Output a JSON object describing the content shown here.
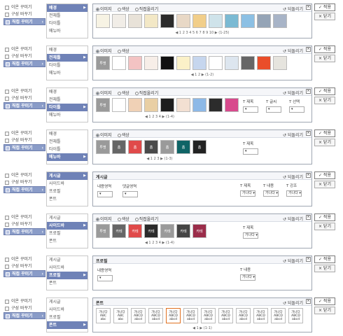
{
  "left_menu": {
    "items": [
      {
        "icon": "magnifier-icon",
        "label": "이온 꾸미기"
      },
      {
        "icon": "doc-icon",
        "label": "구성 바꾸기"
      },
      {
        "icon": "pencil-icon",
        "label": "직접 꾸미기",
        "selected": true
      }
    ]
  },
  "rows": [
    {
      "mid": [
        "배경",
        "전체틀",
        "타이틀",
        "메뉴바"
      ],
      "mid_sel": 0,
      "radios": [
        "이미지",
        "색상",
        "직접올리기"
      ],
      "radio_on": 0,
      "reset": "되돌리기",
      "thumb_colors": [
        "#f7f3e4",
        "#f1ede7",
        "#e8e2d8",
        "#f3e8c6",
        "#2b2b2b",
        "#e8d8c6",
        "#f1ce8a",
        "#cfe3ea",
        "#7bbad3",
        "#8cc0e4",
        "#95a4b6",
        "#a8b4c7"
      ],
      "pager": "◀ 1 2 3 4 5 6 7 8 9 10 ▶ (1-25)"
    },
    {
      "mid": [
        "배경",
        "전체틀",
        "타이틀",
        "메뉴바"
      ],
      "mid_sel": 1,
      "radios": [
        "이미지",
        "색상"
      ],
      "radio_on": 0,
      "reset": "되돌리기",
      "thumb_colors": [
        "#9a9a9a",
        "#ffffff",
        "#f3c3c3",
        "#f7eee8",
        "#111111",
        "#fbf1c8",
        "#c6d6ee",
        "#ffffff",
        "#dde6ef",
        "#666666",
        "#ea4e2a",
        "#e6e4de"
      ],
      "thumb_labels": [
        "투명",
        "",
        "",
        "",
        "",
        "",
        "",
        "",
        "",
        "",
        "",
        ""
      ],
      "pager": "◀ 1 2 ▶ (1-2)"
    },
    {
      "mid": [
        "배경",
        "전체틀",
        "타이틀",
        "메뉴바"
      ],
      "mid_sel": 2,
      "radios": [
        "이미지",
        "색상",
        "직접올리기"
      ],
      "radio_on": 0,
      "reset": "되돌리기",
      "thumb_colors": [
        "#9a9a9a",
        "#ffffff",
        "#f0d1b6",
        "#e9cfa4",
        "#1e1e1e",
        "#f3e0d2",
        "#8db9e7",
        "#2c2c2c",
        "#d84a8d"
      ],
      "thumb_labels": [
        "투명",
        "",
        "",
        "",
        "",
        "",
        "",
        "",
        ""
      ],
      "pager": "◀ 1 2 3 4 ▶ (1-4)",
      "opts": [
        {
          "label": "T 제목",
          "value": ""
        },
        {
          "label": "T 글씨",
          "value": ""
        },
        {
          "label": "T 선택",
          "value": ""
        }
      ]
    },
    {
      "mid": [
        "배경",
        "전체틀",
        "타이틀",
        "메뉴바"
      ],
      "mid_sel": 3,
      "radios": [
        "이미지",
        "색상"
      ],
      "radio_on": 0,
      "reset": "되돌리기",
      "thumb_colors": [
        "#9a9a9a",
        "#666666",
        "#e04a4a",
        "#4a4a4a",
        "#9a9a9a",
        "#0f6466",
        "#222222"
      ],
      "thumb_labels": [
        "투명",
        "홈",
        "홈",
        "홈",
        "홈",
        "홈",
        "홈"
      ],
      "pager": "◀ 1 2 3 ▶ (1-3)",
      "opts": [
        {
          "label": "T 제목",
          "value": ""
        }
      ]
    },
    {
      "mid": [
        "게시글",
        "사이드바",
        "프로필",
        "폰트"
      ],
      "mid_sel": 0,
      "title": "게시글",
      "reset": "되돌리기",
      "areas": [
        "내용영역",
        "댓글영역"
      ],
      "opts": [
        {
          "label": "T 제목",
          "value": "가나다"
        },
        {
          "label": "T 내용",
          "value": "가나다"
        },
        {
          "label": "T 강조",
          "value": "가나다"
        }
      ]
    },
    {
      "mid": [
        "게시글",
        "사이드바",
        "프로필",
        "폰트"
      ],
      "mid_sel": 1,
      "radios": [
        "이미지",
        "색상",
        "직접올리기"
      ],
      "radio_on": 0,
      "reset": "되돌리기",
      "thumb_colors": [
        "#9a9a9a",
        "#666666",
        "#e04a4a",
        "#2b2b2b",
        "#9a9a9a",
        "#444444",
        "#9b2d4a"
      ],
      "thumb_labels": [
        "투명",
        "카테",
        "카테",
        "카테",
        "카테",
        "카테",
        "카테"
      ],
      "pager": "◀ 1 2 3 4 ▶ (1-4)",
      "opts": [
        {
          "label": "T 제목",
          "value": "가나다"
        }
      ]
    },
    {
      "mid": [
        "게시글",
        "사이드바",
        "프로필",
        "폰트"
      ],
      "mid_sel": 2,
      "title": "프로필",
      "reset": "되돌리기",
      "areas": [
        "내용영역"
      ],
      "opts": [
        {
          "label": "T 내용",
          "value": "가나다"
        }
      ]
    },
    {
      "mid": [
        "게시글",
        "사이드바",
        "프로필",
        "폰트"
      ],
      "mid_sel": 3,
      "title": "폰트",
      "reset": "되돌리기",
      "fonts": [
        "가나다\nABC\nabc",
        "가나다\nABC\nabc",
        "가나다\nABCD\nabcd",
        "가나다\nABCD\nabcd",
        "가나다\nABCD\nabcd",
        "가나다\nABCD\nabcd",
        "가나다\nABCD\nabcd",
        "가나다\nABCD\nabcd",
        "가나다\nABCD\nabcd",
        "가나다\nABCD\nabcd",
        "가나다\nABCD\nabcd",
        "가나다\nABCD\nabcd"
      ],
      "pager": "◀ 1 ▶ (1-1)"
    }
  ],
  "buttons": {
    "apply": "✓ 적용",
    "close": "× 닫기"
  }
}
